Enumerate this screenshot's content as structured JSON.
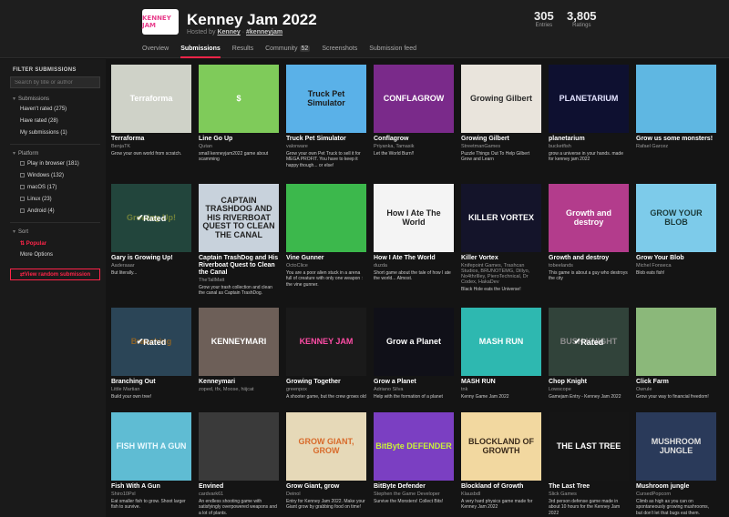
{
  "header": {
    "logo_text": "KENNEY JAM",
    "title": "Kenney Jam 2022",
    "hosted_prefix": "Hosted by",
    "host": "Kenney",
    "hashtag": "#kenneyjam",
    "stats": [
      {
        "num": "305",
        "label": "Entries"
      },
      {
        "num": "3,805",
        "label": "Ratings"
      }
    ],
    "tabs": [
      {
        "label": "Overview"
      },
      {
        "label": "Submissions",
        "active": true
      },
      {
        "label": "Results"
      },
      {
        "label": "Community",
        "count": "52"
      },
      {
        "label": "Screenshots"
      },
      {
        "label": "Submission feed"
      }
    ]
  },
  "sidebar": {
    "heading": "FILTER SUBMISSIONS",
    "search_placeholder": "Search by title or author",
    "submissions_label": "Submissions",
    "submission_filters": [
      "Haven't rated (275)",
      "Have rated (28)",
      "My submissions (1)"
    ],
    "platform_label": "Platform",
    "platforms": [
      "Play in browser (181)",
      "Windows (132)",
      "macOS (17)",
      "Linux (23)",
      "Android (4)"
    ],
    "sort_label": "Sort",
    "popular_label": "Popular",
    "more_options": "More Options",
    "random_button": "View random submission"
  },
  "rated_label": "Rated",
  "games": [
    {
      "title": "Terraforma",
      "author": "BenjaTK",
      "desc": "Grow your own world from scratch.",
      "thumb": "Terraforma",
      "bg": "#cfd2c8",
      "fg": "#ffffff",
      "rated": false
    },
    {
      "title": "Line Go Up",
      "author": "Qutan",
      "desc": "small kenneyjam2022 game about scamming",
      "thumb": "$",
      "bg": "#7fcb5a",
      "fg": "#ffffff",
      "rated": false
    },
    {
      "title": "Truck Pet Simulator",
      "author": "valorware",
      "desc": "Grow your own Pet Truck to sell it for MEGA PROFIT. You have to keep it happy though... or else!",
      "thumb": "Truck Pet Simulator",
      "bg": "#5ab1e8",
      "fg": "#1b1b1b",
      "rated": false
    },
    {
      "title": "Conflagrow",
      "author": "Priyanka, Tamasik",
      "desc": "Let the World Burn!!",
      "thumb": "CONFLAGROW",
      "bg": "#7a2a8a",
      "fg": "#ffffff",
      "rated": false
    },
    {
      "title": "Growing Gilbert",
      "author": "StreetmanGames",
      "desc": "Puzzle Things Out To Help Gilbert Grow and Learn",
      "thumb": "Growing Gilbert",
      "bg": "#e9e4dc",
      "fg": "#2a2a2a",
      "rated": false
    },
    {
      "title": "planetarium",
      "author": "bucketfish",
      "desc": "grow a universe in your hands. made for kenney jam 2022",
      "thumb": "PLANETARIUM",
      "bg": "#0e1030",
      "fg": "#e3e3ff",
      "rated": false
    },
    {
      "title": "Grow us some monsters!",
      "author": "Rafael Garcez",
      "desc": "",
      "thumb": "",
      "bg": "#5fb7e2",
      "fg": "#ffffff",
      "rated": false
    },
    {
      "title": "Gary is Growing Up!",
      "author": "Aaderaaar",
      "desc": "But literally...",
      "thumb": "Growing Up!",
      "bg": "#3e7f6e",
      "fg": "#cde96a",
      "rated": true
    },
    {
      "title": "Captain TrashDog and His Riverboat Quest to Clean the Canal",
      "author": "TheTallMatt",
      "desc": "Grow your trash collection and clean the canal as Captain TrashDog.",
      "thumb": "CAPTAIN TRASHDOG AND HIS RIVERBOAT QUEST TO CLEAN THE CANAL",
      "bg": "#c8d2dc",
      "fg": "#222222",
      "rated": false
    },
    {
      "title": "Vine Gunner",
      "author": "OctoClice",
      "desc": "You are a poor alien stuck in a arena full of creature with only one weapon : the vine gunner.",
      "thumb": "",
      "bg": "#3cb84c",
      "fg": "#ffffff",
      "rated": false
    },
    {
      "title": "How I Ate The World",
      "author": "duzda",
      "desc": "Short game about the tale of how I ate the world... Almost.",
      "thumb": "How I Ate The World",
      "bg": "#f4f4f4",
      "fg": "#222222",
      "rated": false
    },
    {
      "title": "Killer Vortex",
      "author": "Knifepoint Games, Trashcan Studios, BRUNOTEMG, Dillyo, No4thrIlley, PieroTechnical, Dr Codex, HakaDev",
      "desc": "Black Hole eats the Universe!",
      "thumb": "KILLER VORTEX",
      "bg": "#14142a",
      "fg": "#ffffff",
      "rated": false
    },
    {
      "title": "Growth and destroy",
      "author": "tobeelands",
      "desc": "This game is about a guy who destroys the city",
      "thumb": "Growth and destroy",
      "bg": "#b33c8c",
      "fg": "#ffffff",
      "rated": false
    },
    {
      "title": "Grow Your Blob",
      "author": "Michel Fonseca",
      "desc": "Blob eats fish!",
      "thumb": "GROW YOUR BLOB",
      "bg": "#7dcbea",
      "fg": "#1b3a3a",
      "rated": false
    },
    {
      "title": "Branching Out",
      "author": "Little Martian",
      "desc": "Build your own tree!",
      "thumb": "Branching",
      "bg": "#4f7f9e",
      "fg": "#ffb347",
      "rated": true
    },
    {
      "title": "Kenneymari",
      "author": "zoped, tfx, Moose, hiijcat",
      "desc": "",
      "thumb": "KENNEYMARI",
      "bg": "#6d5f58",
      "fg": "#ffffff",
      "rated": false
    },
    {
      "title": "Growing Together",
      "author": "greenpox",
      "desc": "A shooter game, but the crew grows old",
      "thumb": "KENNEY JAM",
      "bg": "#1a1a1a",
      "fg": "#ff4da6",
      "rated": false
    },
    {
      "title": "Grow a Planet",
      "author": "Adriano Silva",
      "desc": "Help with the formation of a planet",
      "thumb": "Grow a Planet",
      "bg": "#101018",
      "fg": "#ffffff",
      "rated": false
    },
    {
      "title": "MASH RUN",
      "author": "tnk",
      "desc": "Kenny Game Jam 2022",
      "thumb": "MASH RUN",
      "bg": "#2eb8b0",
      "fg": "#ffffff",
      "rated": false
    },
    {
      "title": "Chop Knight",
      "author": "Lowscope",
      "desc": "Gamejam Entry - Kenney Jam 2022",
      "thumb": "BUSH KNIGHT",
      "bg": "#5a7a6a",
      "fg": "#ffffff",
      "rated": true
    },
    {
      "title": "Click Farm",
      "author": "Owrule",
      "desc": "Grow your way to financial freedom!",
      "thumb": "",
      "bg": "#8bb87a",
      "fg": "#ffffff",
      "rated": false
    },
    {
      "title": "Fish With A Gun",
      "author": "Shiro10Pxl",
      "desc": "Eat smaller fish to grow. Shoot larger fish to survive.",
      "thumb": "FISH WITH A GUN",
      "bg": "#5fbcd3",
      "fg": "#eafaff",
      "rated": false
    },
    {
      "title": "Envined",
      "author": "cardvark61",
      "desc": "An endless shooting game with satisfyingly overpowered weapons and a lot of plants.",
      "thumb": "",
      "bg": "#3a3a3a",
      "fg": "#ffffff",
      "rated": false
    },
    {
      "title": "Grow Giant, grow",
      "author": "Deinol",
      "desc": "Entry for Kenney Jam 2022. Make your Giant grow by grabbing food on time!",
      "thumb": "GROW GIANT, GROW",
      "bg": "#e6d9b8",
      "fg": "#d86a2a",
      "rated": false
    },
    {
      "title": "BitByte Defender",
      "author": "Stephen the Game Developer",
      "desc": "Survive the Monsters! Collect Bits!",
      "thumb": "BitByte DEFENDER",
      "bg": "#7b3fc2",
      "fg": "#c8f03a",
      "rated": false
    },
    {
      "title": "Blockland of Growth",
      "author": "Klausbdl",
      "desc": "A very hard physics game made for Kenney Jam 2022",
      "thumb": "BLOCKLAND OF GROWTH",
      "bg": "#f2d8a0",
      "fg": "#3a2a1a",
      "rated": false
    },
    {
      "title": "The Last Tree",
      "author": "Slick Games",
      "desc": "3rd person defense game made in about 10 hours for the Kenney Jam 2022",
      "thumb": "THE LAST TREE",
      "bg": "#151515",
      "fg": "#ffffff",
      "rated": false
    },
    {
      "title": "Mushroom jungle",
      "author": "CursedPopcorn",
      "desc": "Climb as high as you can on spontaneously growing mushrooms, but don't let that bugs eat them.",
      "thumb": "MUSHROOM JUNGLE",
      "bg": "#2a3a5a",
      "fg": "#e0e0e0",
      "rated": false
    }
  ]
}
